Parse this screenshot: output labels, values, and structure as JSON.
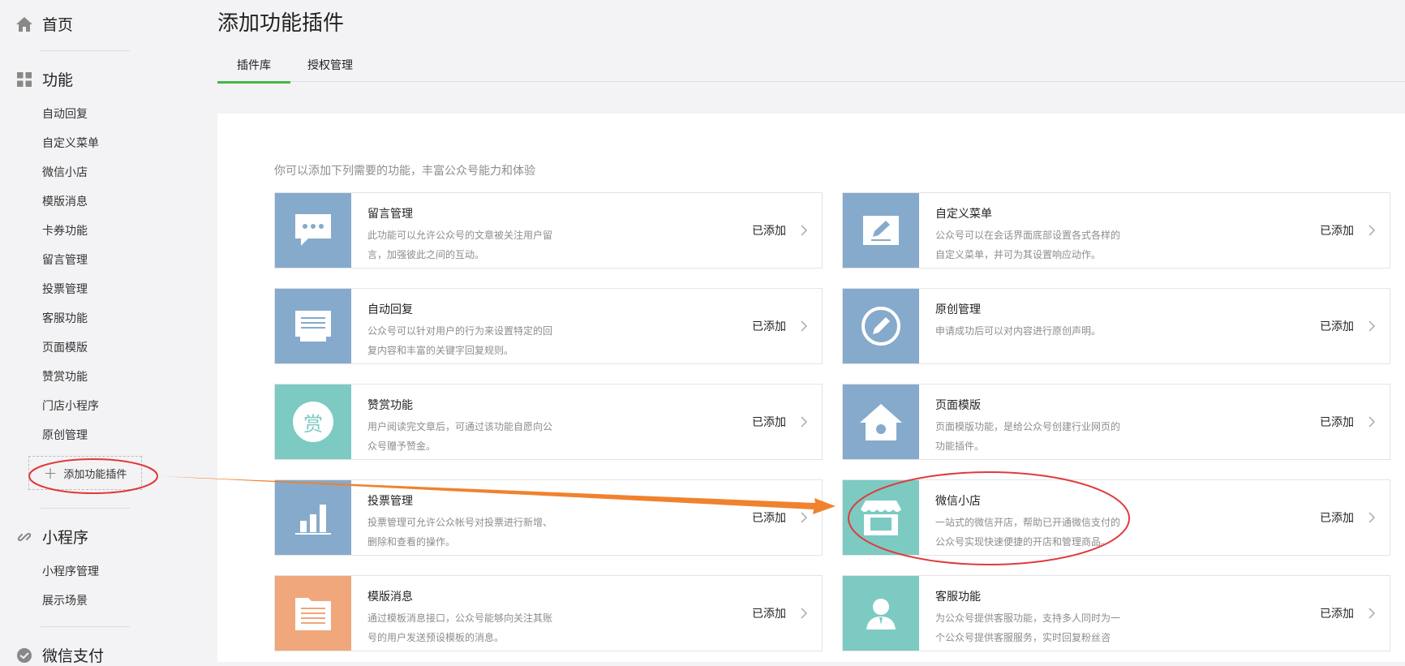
{
  "sidebar": {
    "home": "首页",
    "features": "功能",
    "feature_items": [
      "自动回复",
      "自定义菜单",
      "微信小店",
      "模版消息",
      "卡券功能",
      "留言管理",
      "投票管理",
      "客服功能",
      "页面模版",
      "赞赏功能",
      "门店小程序",
      "原创管理"
    ],
    "add_plugin": "添加功能插件",
    "miniprogram": "小程序",
    "miniprogram_items": [
      "小程序管理",
      "展示场景"
    ],
    "pay": "微信支付"
  },
  "header": {
    "title": "添加功能插件",
    "tabs": [
      "插件库",
      "授权管理"
    ],
    "active_tab": 0
  },
  "main": {
    "intro": "你可以添加下列需要的功能，丰富公众号能力和体验",
    "plugins": [
      {
        "name": "留言管理",
        "desc": "此功能可以允许公众号的文章被关注用户留言，加强彼此之间的互动。",
        "state": "已添加",
        "icon": "speech-bubble-icon",
        "color": "#86aacb"
      },
      {
        "name": "自定义菜单",
        "desc": "公众号可以在会话界面底部设置各式各样的自定义菜单，并可为其设置响应动作。",
        "state": "已添加",
        "icon": "edit-pen-icon",
        "color": "#86aacb"
      },
      {
        "name": "自动回复",
        "desc": "公众号可以针对用户的行为来设置特定的回复内容和丰富的关键字回复规则。",
        "state": "已添加",
        "icon": "message-lines-icon",
        "color": "#86aacb"
      },
      {
        "name": "原创管理",
        "desc": "申请成功后可以对内容进行原创声明。",
        "state": "已添加",
        "icon": "circle-pen-icon",
        "color": "#86aacb"
      },
      {
        "name": "赞赏功能",
        "desc": "用户阅读完文章后，可通过该功能自愿向公众号赠予赞金。",
        "state": "已添加",
        "icon": "reward-icon",
        "color": "#7ccac2",
        "icon_text": "赏"
      },
      {
        "name": "页面模版",
        "desc": "页面模版功能，是给公众号创建行业网页的功能插件。",
        "state": "已添加",
        "icon": "house-icon",
        "color": "#86aacb"
      },
      {
        "name": "投票管理",
        "desc": "投票管理可允许公众帐号对投票进行新增、删除和查看的操作。",
        "state": "已添加",
        "icon": "bar-chart-icon",
        "color": "#86aacb"
      },
      {
        "name": "微信小店",
        "desc": "一站式的微信开店，帮助已开通微信支付的公众号实现快速便捷的开店和管理商品。",
        "state": "已添加",
        "icon": "storefront-icon",
        "color": "#7ccac2"
      },
      {
        "name": "模版消息",
        "desc": "通过模板消息接口，公众号能够向关注其账号的用户发送预设模板的消息。",
        "state": "已添加",
        "icon": "document-icon",
        "color": "#efa77b"
      },
      {
        "name": "客服功能",
        "desc": "为公众号提供客服功能，支持多人同时为一个公众号提供客服服务，实时回复粉丝咨",
        "state": "已添加",
        "icon": "person-icon",
        "color": "#7ccac2"
      }
    ]
  },
  "annotation": {
    "color": "#e03a3a",
    "arrow_color": "#f0822e"
  }
}
